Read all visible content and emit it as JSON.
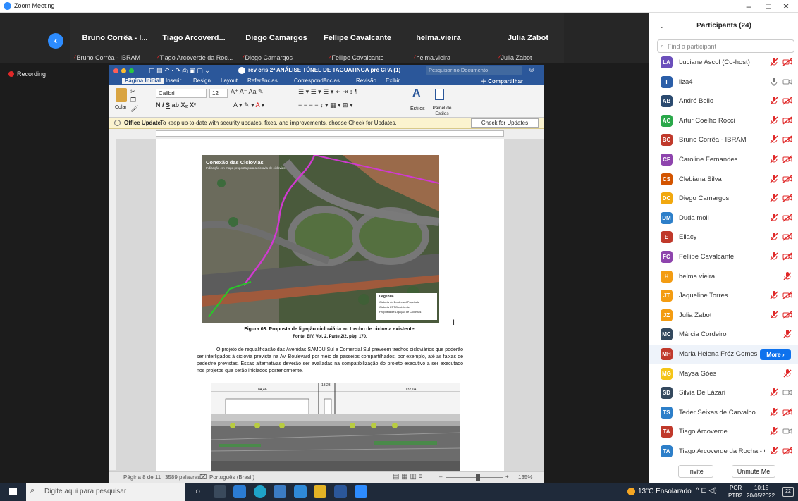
{
  "window": {
    "title": "Zoom Meeting",
    "minimize": "–",
    "maximize": "□",
    "close": "✕"
  },
  "recording": "Recording",
  "thumbnails": [
    {
      "name": "Bruno Corrêa - I...",
      "sub": "Bruno Corrêa - IBRAM"
    },
    {
      "name": "Tiago Arcoverd...",
      "sub": "Tiago Arcoverde da Roc..."
    },
    {
      "name": "Diego Camargos",
      "sub": "Diego Camargos"
    },
    {
      "name": "Fellipe Cavalcante",
      "sub": "Fellipe Cavalcante"
    },
    {
      "name": "helma.vieira",
      "sub": "helma.vieira"
    },
    {
      "name": "Julia Zabot",
      "sub": "Julia Zabot"
    }
  ],
  "word": {
    "doc_title": "rev cris 2ª ANÁLISE TÚNEL DE TAGUATINGA pré CPA (1)",
    "search_placeholder": "Pesquisar no Documento",
    "tabs": [
      "Página Inicial",
      "Inserir",
      "Design",
      "Layout",
      "Referências",
      "Correspondências",
      "Revisão",
      "Exibir"
    ],
    "share": "Compartilhar",
    "paste_label": "Colar",
    "font": "Calibri",
    "font_size": "12",
    "styles_label": "Estilos",
    "styles_pane_label": "Painel de Estilos",
    "update_title": "Office Update",
    "update_msg": "To keep up-to-date with security updates, fixes, and improvements, choose Check for Updates.",
    "update_button": "Check for Updates",
    "status": {
      "page": "Página 8 de 11",
      "words": "3589 palavras",
      "lang": "Português (Brasil)",
      "zoom": "135%"
    }
  },
  "doc": {
    "map_title": "Conexão das Ciclovias",
    "map_subtitle": "Indicação em mapa proposta para a ciclovia de ciclovias",
    "legend_title": "Legenda",
    "legend_items": [
      "Ciclovia do Boulevard Projetada",
      "Ciclovia EPTG existente",
      "Proposta de Ligação de Ciclovias"
    ],
    "caption_1": "Figura 03. Proposta de ligação cicloviária ao trecho de ciclovia existente.",
    "caption_2": "Fonte: EIV, Vol. 2, Parte 2/2, pág. 170.",
    "paragraph": "O projeto de requalificação das Avenidas SAMDU Sul e Comercial Sul preveem trechos cicloviários que poderão ser interligados à ciclovia prevista na Av. Boulevard por meio de passeios compartilhados, por exemplo, até as faixas de pedestre previstas. Essas alternativas deverão ser avaliadas na compatibilização do projeto executivo a ser executado nos projetos que serão iniciados posteriormente.",
    "dim_labels": [
      "84,46",
      "13,23",
      "132,04"
    ]
  },
  "participants": {
    "title": "Participants (24)",
    "search_placeholder": "Find a participant",
    "list": [
      {
        "initials": "LA",
        "name": "Luciane Ascol (Co-host)",
        "color": "#6b4fbb",
        "mic": "muted",
        "cam": "off"
      },
      {
        "initials": "I",
        "name": "ilza4",
        "color": "#2b5ea8",
        "mic": "on",
        "cam": "offline"
      },
      {
        "initials": "AB",
        "name": "André Bello",
        "color": "#2b4a6f",
        "mic": "muted",
        "cam": "off"
      },
      {
        "initials": "AC",
        "name": "Artur Coelho Rocci",
        "color": "#2aa84a",
        "mic": "muted",
        "cam": "off"
      },
      {
        "initials": "BC",
        "name": "Bruno Corrêa - IBRAM",
        "color": "#c0392b",
        "mic": "muted",
        "cam": "off"
      },
      {
        "initials": "CF",
        "name": "Caroline Fernandes",
        "color": "#8e44ad",
        "mic": "muted",
        "cam": "off"
      },
      {
        "initials": "CS",
        "name": "Clebiana Silva",
        "color": "#d35400",
        "mic": "muted",
        "cam": "off"
      },
      {
        "initials": "DC",
        "name": "Diego Camargos",
        "color": "#f1a80f",
        "mic": "muted",
        "cam": "off"
      },
      {
        "initials": "DM",
        "name": "Duda moll",
        "color": "#2d7fc9",
        "mic": "muted",
        "cam": "off"
      },
      {
        "initials": "E",
        "name": "Eliacy",
        "color": "#c0392b",
        "mic": "muted",
        "cam": "off"
      },
      {
        "initials": "FC",
        "name": "Fellipe Cavalcante",
        "color": "#8e44ad",
        "mic": "muted",
        "cam": "off"
      },
      {
        "initials": "H",
        "name": "helma.vieira",
        "color": "#f39c12",
        "mic": "muted",
        "cam": "none"
      },
      {
        "initials": "JT",
        "name": "Jaqueline Torres",
        "color": "#f39c12",
        "mic": "muted",
        "cam": "off"
      },
      {
        "initials": "JZ",
        "name": "Julia Zabot",
        "color": "#f39c12",
        "mic": "muted",
        "cam": "off"
      },
      {
        "initials": "MC",
        "name": "Márcia Cordeiro",
        "color": "#34495e",
        "mic": "muted",
        "cam": "none"
      },
      {
        "initials": "MH",
        "name": "Maria Helena Fróz Gomes",
        "color": "#c0392b",
        "mic": "hidden",
        "cam": "hidden",
        "more": "More"
      },
      {
        "initials": "MG",
        "name": "Maysa Góes",
        "color": "#f5c518",
        "mic": "muted",
        "cam": "none"
      },
      {
        "initials": "SD",
        "name": "Silvia De Lázari",
        "color": "#34495e",
        "mic": "muted",
        "cam": "offline"
      },
      {
        "initials": "TS",
        "name": "Teder Seixas de Carvalho",
        "color": "#2d7fc9",
        "mic": "muted",
        "cam": "off"
      },
      {
        "initials": "TA",
        "name": "Tiago Arcoverde",
        "color": "#c0392b",
        "mic": "muted",
        "cam": "offline"
      },
      {
        "initials": "TA",
        "name": "Tiago Arcoverde da Rocha - C...",
        "color": "#2d7fc9",
        "mic": "muted",
        "cam": "off"
      }
    ],
    "invite": "Invite",
    "unmute": "Unmute Me"
  },
  "taskbar": {
    "search": "Digite aqui para pesquisar",
    "weather": "13°C Ensolarado",
    "lang1": "POR",
    "lang2": "PTB2",
    "time": "10:15",
    "date": "20/05/2022",
    "notif_count": "22"
  }
}
